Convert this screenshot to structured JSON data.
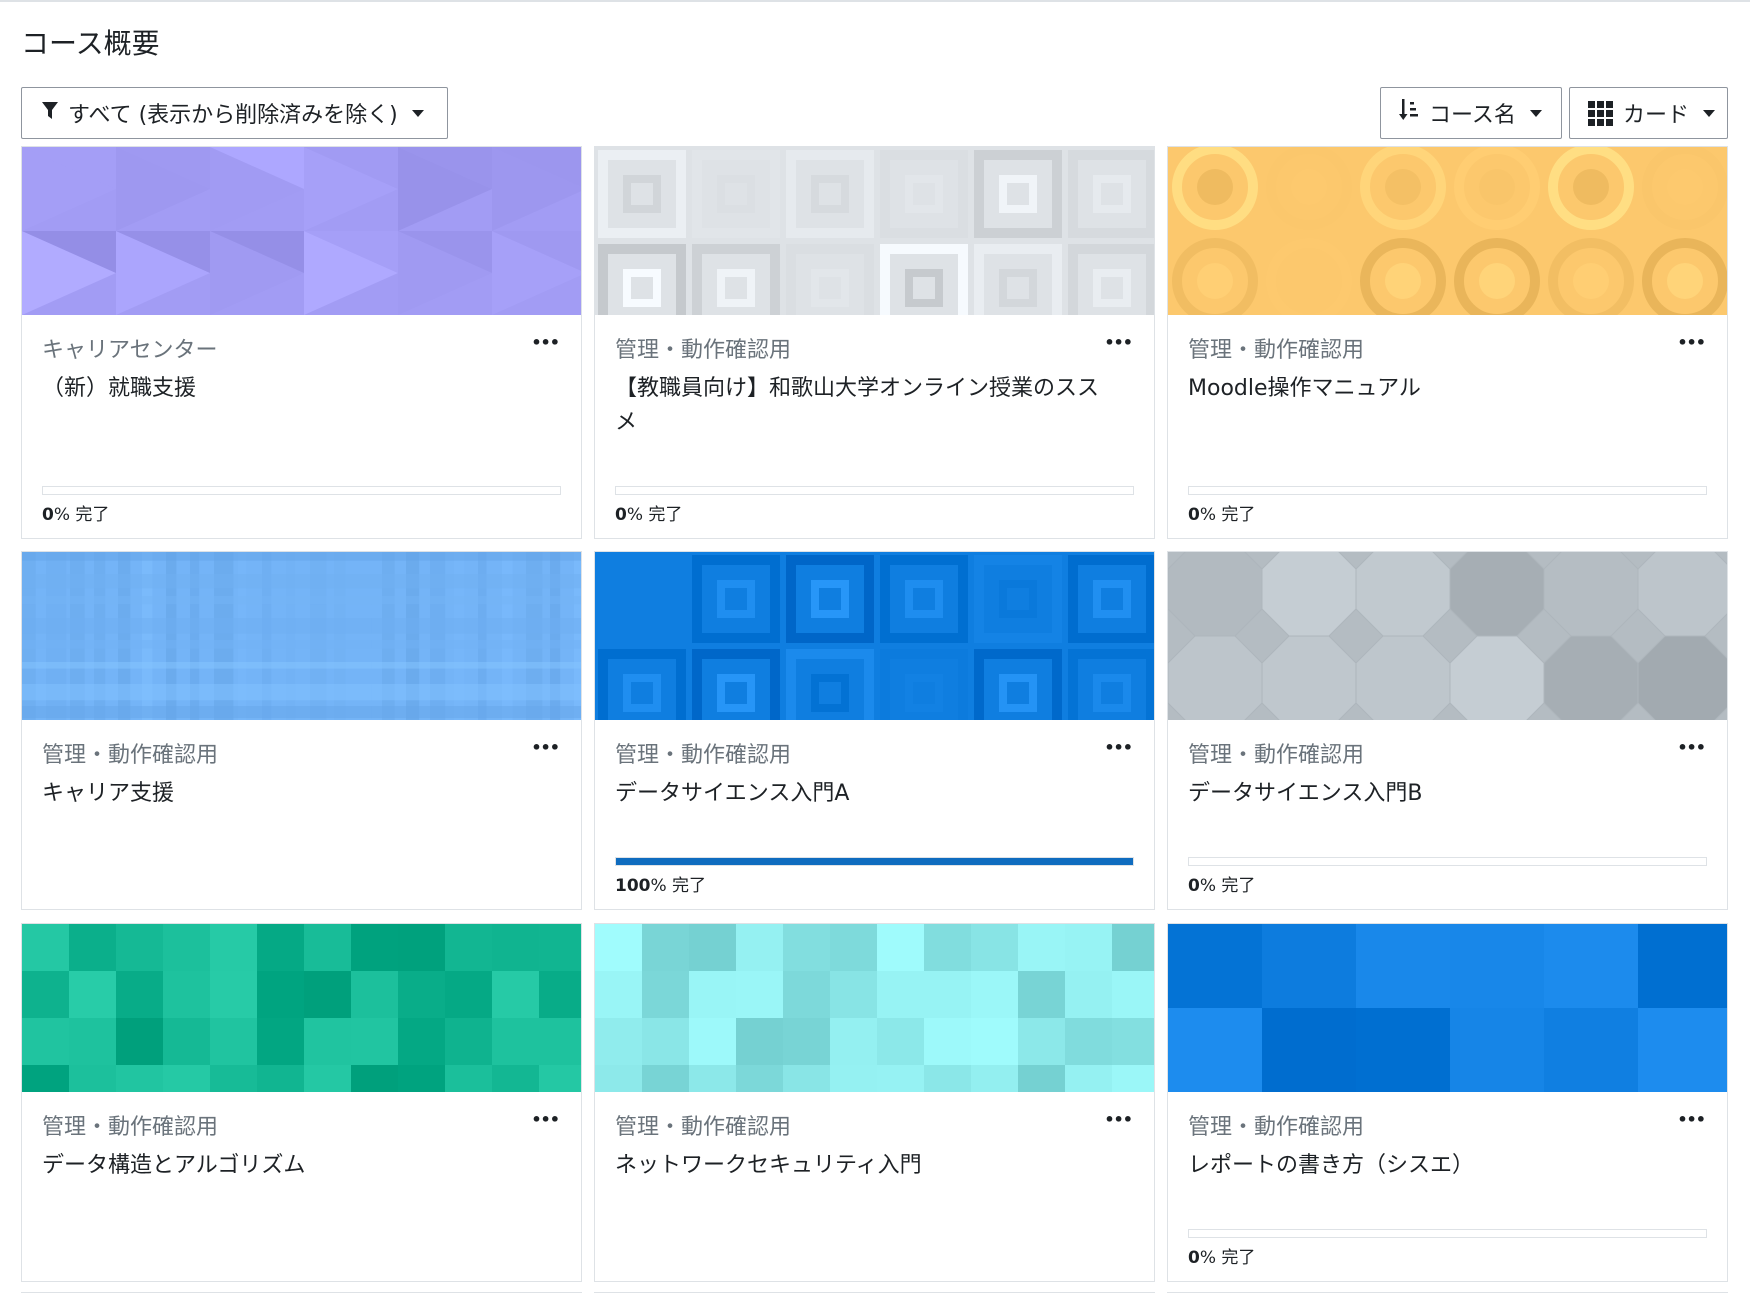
{
  "page_title": "コース概要",
  "controls": {
    "filter_label": "すべて (表示から削除済みを除く)",
    "sort_label": "コース名",
    "view_label": "カード"
  },
  "completion_suffix": "% 完了",
  "courses": [
    {
      "category": "キャリアセンター",
      "name": "（新）就職支援",
      "progress": 0,
      "show_progress": true,
      "color": "#a29cf4"
    },
    {
      "category": "管理・動作確認用",
      "name": "【教職員向け】和歌山大学オンライン授業のススメ",
      "progress": 0,
      "show_progress": true,
      "color": "#dee2e6"
    },
    {
      "category": "管理・動作確認用",
      "name": "Moodle操作マニュアル",
      "progress": 0,
      "show_progress": true,
      "color": "#fcc86d"
    },
    {
      "category": "管理・動作確認用",
      "name": "キャリア支援",
      "progress": null,
      "show_progress": false,
      "color": "#74b4f7"
    },
    {
      "category": "管理・動作確認用",
      "name": "データサイエンス入門A",
      "progress": 100,
      "show_progress": true,
      "color": "#0f7ee0"
    },
    {
      "category": "管理・動作確認用",
      "name": "データサイエンス入門B",
      "progress": 0,
      "show_progress": true,
      "color": "#b4bcc2"
    },
    {
      "category": "管理・動作確認用",
      "name": "データ構造とアルゴリズム",
      "progress": null,
      "show_progress": false,
      "color": "#12b692"
    },
    {
      "category": "管理・動作確認用",
      "name": "ネットワークセキュリティ入門",
      "progress": null,
      "show_progress": false,
      "color": "#8be7e8"
    },
    {
      "category": "管理・動作確認用",
      "name": "レポートの書き方（シスエ）",
      "progress": 0,
      "show_progress": true,
      "color": "#0f7ee0"
    }
  ]
}
